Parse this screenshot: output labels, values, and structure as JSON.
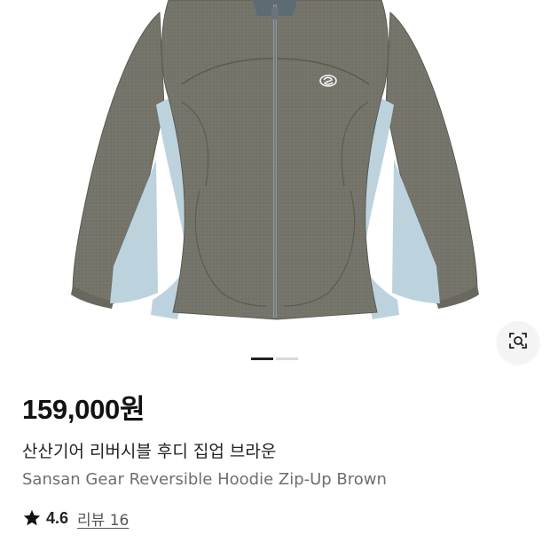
{
  "product": {
    "price": "159,000원",
    "name_ko": "산산기어 리버시블 후디 집업 브라운",
    "name_en": "Sansan Gear Reversible Hoodie Zip-Up Brown",
    "rating": "4.6",
    "review_link": "리뷰 16",
    "image_icon": "reversible-hoodie-jacket-photo"
  },
  "gallery": {
    "image_count": 2,
    "active_index": 0
  },
  "icons": {
    "lens": "image-search-icon",
    "star": "star-icon"
  },
  "colors": {
    "jacket_body": "#74746a",
    "jacket_panel": "#bcd3de",
    "indicator_active": "#222222",
    "indicator_inactive": "#d9d9d9"
  }
}
